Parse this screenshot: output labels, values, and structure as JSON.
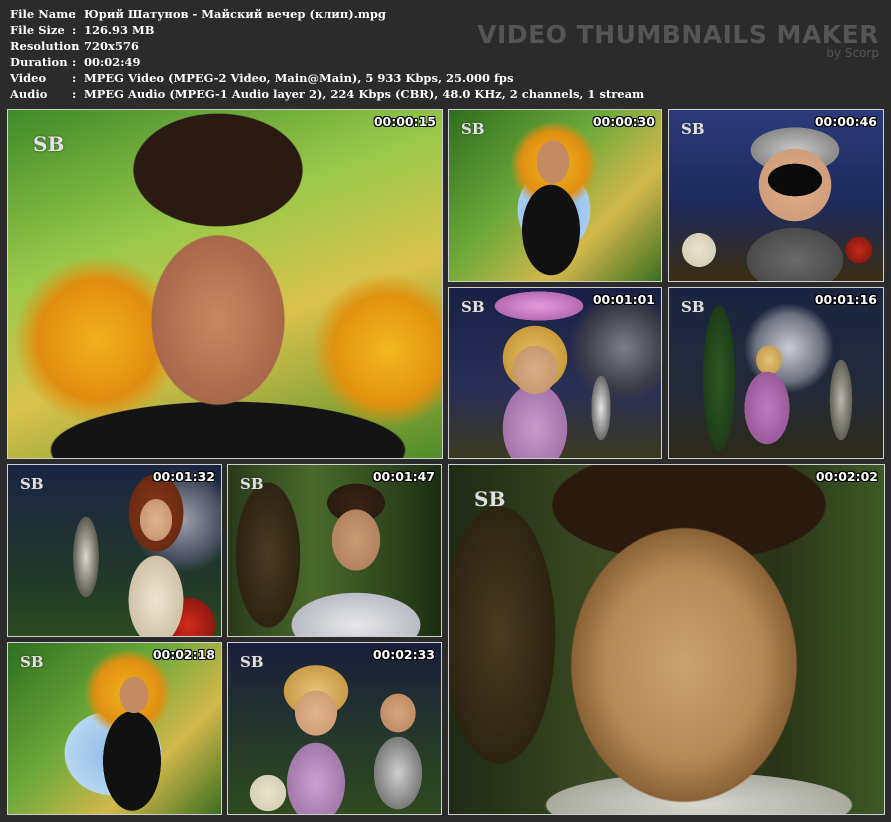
{
  "info": {
    "rows": [
      {
        "key": "File Name",
        "value": "Юрий Шатунов - Майский вечер (клип).mpg"
      },
      {
        "key": "File Size",
        "value": "126.93 MB"
      },
      {
        "key": "Resolution",
        "value": "720x576"
      },
      {
        "key": "Duration",
        "value": "00:02:49"
      },
      {
        "key": "Video",
        "value": "MPEG Video (MPEG-2 Video, Main@Main), 5 933 Kbps, 25.000 fps"
      },
      {
        "key": "Audio",
        "value": "MPEG Audio (MPEG-1 Audio layer 2), 224 Kbps (CBR), 48.0 KHz, 2 channels, 1 stream"
      }
    ],
    "separator": ":"
  },
  "brand": {
    "title": "VIDEO THUMBNAILS MAKER",
    "by": "by Scorp"
  },
  "logo_text": "SB",
  "thumbnails": [
    {
      "time": "00:00:15"
    },
    {
      "time": "00:00:30"
    },
    {
      "time": "00:00:46"
    },
    {
      "time": "00:01:01"
    },
    {
      "time": "00:01:16"
    },
    {
      "time": "00:01:32"
    },
    {
      "time": "00:01:47"
    },
    {
      "time": "00:02:02"
    },
    {
      "time": "00:02:18"
    },
    {
      "time": "00:02:33"
    }
  ]
}
